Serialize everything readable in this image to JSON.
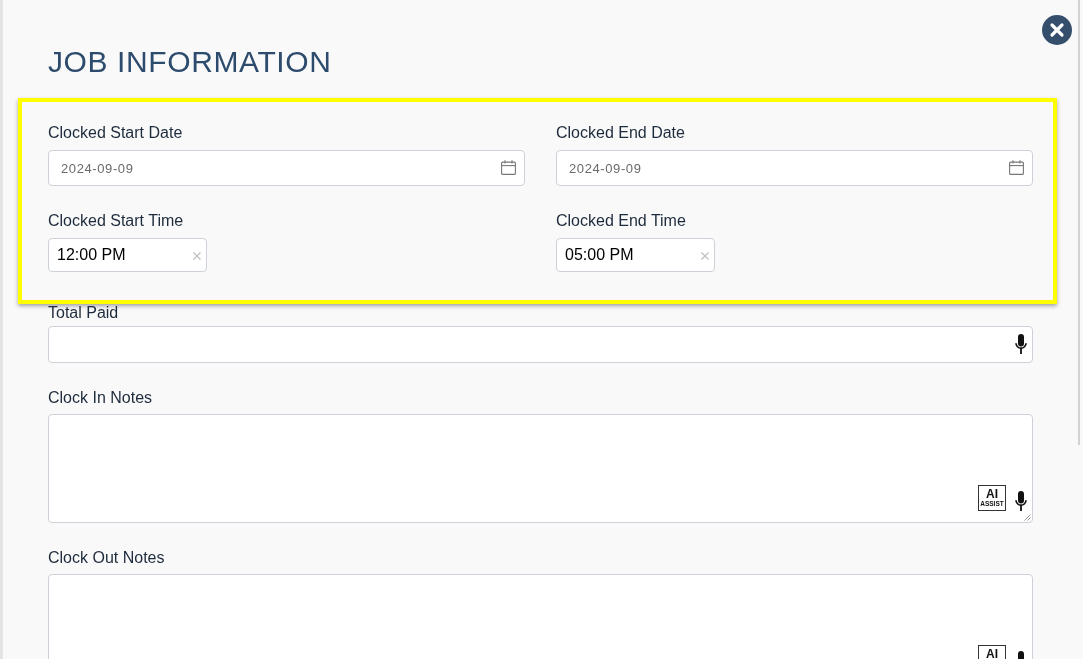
{
  "dialog": {
    "title": "JOB INFORMATION"
  },
  "clocked_times": {
    "highlighted": true,
    "fields": [
      {
        "kind": "date",
        "label": "Clocked Start Date",
        "value": "2024-09-09"
      },
      {
        "kind": "date",
        "label": "Clocked End Date",
        "value": "2024-09-09"
      },
      {
        "kind": "time",
        "label": "Clocked Start Time",
        "value": "12:00 PM"
      },
      {
        "kind": "time",
        "label": "Clocked End Time",
        "value": "05:00 PM"
      }
    ]
  },
  "fields": [
    {
      "kind": "text",
      "label": "Total Paid",
      "voice_input": true
    },
    {
      "kind": "textarea",
      "label": "Clock In Notes",
      "voice_input": true,
      "ai_assist": {
        "title": "AI",
        "subtitle": "ASSIST"
      }
    },
    {
      "kind": "textarea",
      "label": "Clock Out Notes",
      "voice_input": true,
      "ai_assist": {
        "title": "AI"
      }
    }
  ]
}
